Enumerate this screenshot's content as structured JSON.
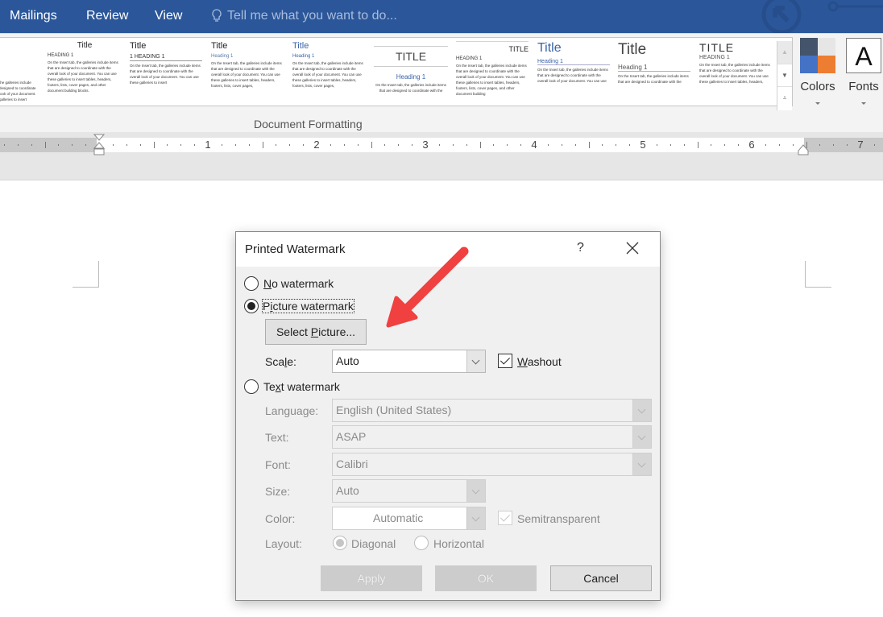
{
  "ribbon_tabs": [
    "Mailings",
    "Review",
    "View"
  ],
  "tell_me": {
    "placeholder": "Tell me what you want to do...",
    "icon": "lightbulb-icon"
  },
  "style_gallery": {
    "group_label": "Document Formatting",
    "items": [
      {
        "title": "",
        "heading": "",
        "body": "the galleries include designed to coordinate look of your document. galleries to insert"
      },
      {
        "title": "Title",
        "heading": "HEADING 1",
        "body": "On the Insert tab, the galleries include items that are designed to coordinate with the overall look of your document. You can use these galleries to insert tables, headers, footers, lists, cover pages, and other document building blocks."
      },
      {
        "title": "Title",
        "heading": "1  HEADING 1",
        "body": "On the Insert tab, the galleries include items that are designed to coordinate with the overall look of your document. You can use these galleries to insert"
      },
      {
        "title": "Title",
        "heading": "Heading 1",
        "body": "On the Insert tab, the galleries include items that are designed to coordinate with the overall look of your document. You can use these galleries to insert tables, headers, footers, lists, cover pages,"
      },
      {
        "title": "Title",
        "heading": "Heading 1",
        "body": "On the Insert tab, the galleries include items that are designed to coordinate with the overall look of your document. You can use these galleries to insert tables, headers, footers, lists, cover pages,"
      },
      {
        "title": "TITLE",
        "heading": "Heading 1",
        "body": "On the Insert tab, the galleries include items that are designed to coordinate with the"
      },
      {
        "title": "TITLE",
        "heading": "HEADING 1",
        "body": "On the Insert tab, the galleries include items that are designed to coordinate with the overall look of your document. You can use these galleries to insert tables, headers, footers, lists, cover pages, and other document building"
      },
      {
        "title": "Title",
        "heading": "Heading 1",
        "body": "On the Insert tab, the galleries include items that are designed to coordinate with the overall look of your document. You can use"
      },
      {
        "title": "Title",
        "heading": "Heading 1",
        "body": "On the Insert tab, the galleries include items that are designed to coordinate with the"
      },
      {
        "title": "TITLE",
        "heading": "HEADING 1",
        "body": "On the Insert tab, the galleries include items that are designed to coordinate with the overall look of your document. You can use these galleries to insert tables, headers,"
      }
    ]
  },
  "colors_button": {
    "label": "Colors",
    "swatches": [
      "#44546a",
      "#e7e6e6",
      "#4472c4",
      "#ed7d31"
    ]
  },
  "fonts_button": {
    "label": "Fonts",
    "glyph": "A"
  },
  "ruler": {
    "numbers": [
      "1",
      "2",
      "3",
      "4",
      "5",
      "6",
      "7"
    ]
  },
  "dialog": {
    "title": "Printed Watermark",
    "help": "?",
    "no_watermark": {
      "accel": "N",
      "rest": "o watermark",
      "checked": false
    },
    "picture_watermark": {
      "pre": "P",
      "accel": "i",
      "rest": "cture watermark",
      "checked": true
    },
    "select_picture": {
      "pre": "Select ",
      "accel": "P",
      "rest": "icture..."
    },
    "scale": {
      "pre": "Sca",
      "accel": "l",
      "rest": "e:",
      "value": "Auto"
    },
    "washout": {
      "accel": "W",
      "rest": "ashout",
      "checked": true
    },
    "text_watermark": {
      "pre": "Te",
      "accel": "x",
      "rest": "t watermark",
      "checked": false
    },
    "language": {
      "label": "Language:",
      "value": "English (United States)"
    },
    "text": {
      "label": "Text:",
      "value": "ASAP"
    },
    "font": {
      "label": "Font:",
      "value": "Calibri"
    },
    "size": {
      "label": "Size:",
      "value": "Auto"
    },
    "color": {
      "label": "Color:",
      "value": "Automatic"
    },
    "semitransparent": {
      "label": "Semitransparent",
      "checked": true
    },
    "layout": {
      "label": "Layout:",
      "diagonal": "Diagonal",
      "horizontal": "Horizontal",
      "selected": "Diagonal"
    },
    "buttons": {
      "apply": "Apply",
      "ok": "OK",
      "cancel": "Cancel"
    }
  },
  "annotation": {
    "type": "red-arrow",
    "color": "#f04040"
  }
}
